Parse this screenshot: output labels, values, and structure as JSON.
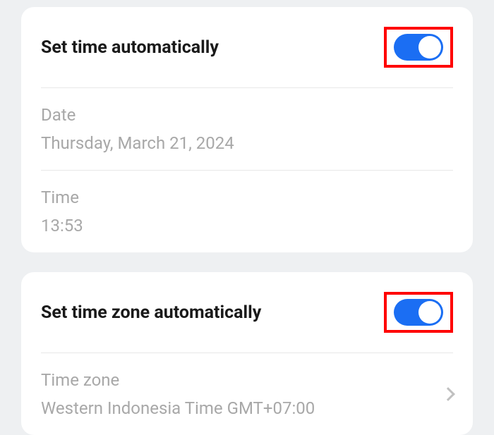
{
  "section1": {
    "title": "Set time automatically",
    "toggle_on": true,
    "date_label": "Date",
    "date_value": "Thursday, March 21, 2024",
    "time_label": "Time",
    "time_value": "13:53"
  },
  "section2": {
    "title": "Set time zone automatically",
    "toggle_on": true,
    "timezone_label": "Time zone",
    "timezone_value": "Western Indonesia Time GMT+07:00"
  },
  "colors": {
    "toggle_active": "#1b6ef3",
    "highlight_border": "#ff0000"
  }
}
